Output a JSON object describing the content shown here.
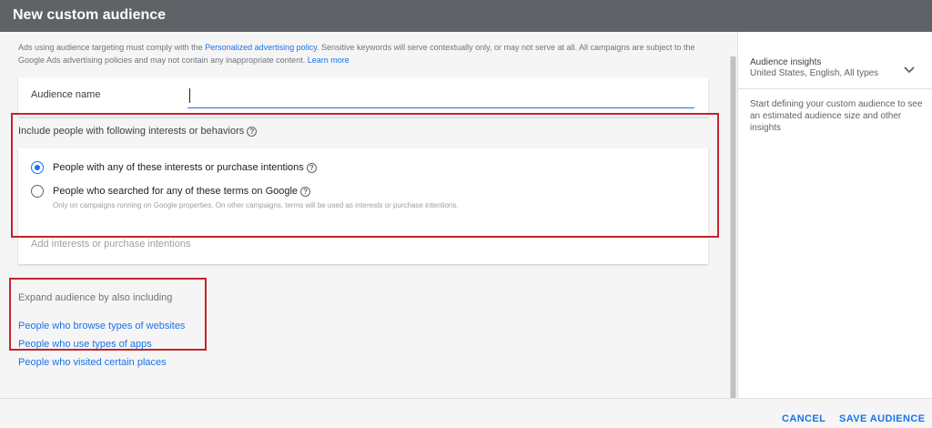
{
  "dialog": {
    "title": "New custom audience"
  },
  "notice": {
    "text_1": "Ads using audience targeting must comply with the ",
    "policy_link": "Personalized advertising policy",
    "text_2": ". Sensitive keywords will serve contextually only, or may not serve at all. All campaigns are subject to the Google Ads advertising policies and may not contain any inappropriate content. ",
    "learn_more": "Learn more"
  },
  "audience_name": {
    "label": "Audience name",
    "value": "",
    "placeholder": ""
  },
  "include": {
    "label": "Include people with following interests or behaviors",
    "option_interests": "People with any of these interests or purchase intentions",
    "option_search": "People who searched for any of these terms on Google",
    "search_note": "Only on campaigns running on Google properties. On other campaigns, terms will be used as interests or purchase intentions.",
    "add_placeholder": "Add interests or purchase intentions",
    "selected": "interests"
  },
  "expand": {
    "label": "Expand audience by also including",
    "links": [
      "People who browse types of websites",
      "People who use types of apps",
      "People who visited certain places"
    ]
  },
  "insights": {
    "title": "Audience insights",
    "subtitle": "United States, English, All types",
    "hint": "Start defining your custom audience to see an estimated audience size and other insights"
  },
  "footer": {
    "cancel": "CANCEL",
    "save": "SAVE AUDIENCE"
  },
  "colors": {
    "accent": "#1a73e8",
    "highlight": "#c5232a",
    "titlebar": "#5f6368"
  }
}
